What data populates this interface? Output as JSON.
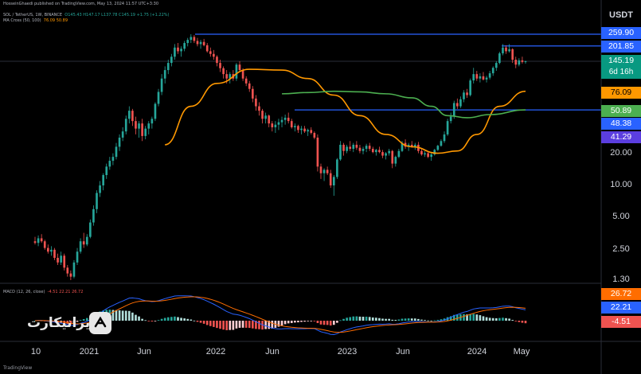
{
  "header": {
    "published": "HosseinGhaedi published on TradingView.com, May 13, 2024 11:57 UTC+3:30",
    "symbol_line": "SOL / TetherUS, 1W, BINANCE",
    "ohlc": "O145.43 H147.17 L137.78 C145.19 +1.75 (+1.22%)",
    "ma_line": "MA Cross (50, 100)",
    "ma_values": "76.09  50.89",
    "macd_line": "MACD (12, 26, close)",
    "macd_values": "-4.51  22.21  26.72"
  },
  "currency": "USDT",
  "price_tags": {
    "high": "259.90",
    "resistance": "201.85",
    "last": "145.19",
    "countdown": "6d 16h",
    "ma50": "76.09",
    "support1": "50.89",
    "support2": "48.38",
    "support3": "41.29",
    "macd": "26.72",
    "signal": "22.21",
    "hist": "-4.51"
  },
  "colors": {
    "up": "#26a69a",
    "down": "#ef5350",
    "level": "#2962ff",
    "ma50": "#ff9800",
    "ma100": "#4caf50",
    "macd": "#2962ff",
    "signal": "#ff6d00",
    "last": "#089981",
    "tag_purple": "#5b3ee0"
  },
  "logo": {
    "text": "ایرانیکارت"
  },
  "footer": "TradingView",
  "chart_data": {
    "type": "candlestick",
    "scale": "log",
    "y_ticks": [
      1.3,
      2.5,
      5.0,
      10.0,
      20.0
    ],
    "x_ticks": [
      "10",
      "2021",
      "Jun",
      "2022",
      "Jun",
      "2023",
      "Jun",
      "2024",
      "May"
    ],
    "levels": [
      259.9,
      201.85,
      50.89
    ],
    "candles": [
      [
        3.0,
        3.3,
        2.8,
        2.9
      ],
      [
        2.9,
        3.4,
        2.7,
        3.2
      ],
      [
        3.2,
        3.5,
        2.9,
        3.0
      ],
      [
        3.0,
        3.1,
        2.5,
        2.6
      ],
      [
        2.6,
        2.8,
        2.3,
        2.4
      ],
      [
        2.4,
        2.7,
        2.2,
        2.5
      ],
      [
        2.5,
        2.6,
        2.0,
        2.1
      ],
      [
        2.1,
        2.3,
        1.8,
        1.9
      ],
      [
        1.9,
        2.4,
        1.8,
        2.2
      ],
      [
        2.2,
        2.3,
        1.6,
        1.7
      ],
      [
        1.7,
        1.8,
        1.4,
        1.5
      ],
      [
        1.5,
        1.6,
        1.3,
        1.4
      ],
      [
        1.4,
        2.0,
        1.35,
        1.9
      ],
      [
        1.9,
        2.6,
        1.8,
        2.4
      ],
      [
        2.4,
        3.2,
        2.3,
        3.0
      ],
      [
        3.0,
        3.6,
        2.6,
        2.8
      ],
      [
        2.8,
        3.5,
        2.7,
        3.3
      ],
      [
        3.3,
        4.8,
        3.2,
        4.5
      ],
      [
        4.5,
        6.5,
        4.2,
        6.0
      ],
      [
        6.0,
        9.0,
        5.5,
        8.5
      ],
      [
        8.5,
        11.0,
        7.8,
        10.0
      ],
      [
        10.0,
        13.0,
        9.0,
        12.5
      ],
      [
        12.5,
        16.0,
        11.5,
        15.0
      ],
      [
        15.0,
        18.5,
        14.0,
        17.0
      ],
      [
        17.0,
        20.0,
        15.5,
        18.5
      ],
      [
        18.5,
        25.0,
        17.5,
        23.0
      ],
      [
        23.0,
        30.0,
        21.0,
        28.0
      ],
      [
        28.0,
        35.0,
        26.0,
        32.0
      ],
      [
        32.0,
        45.0,
        30.0,
        42.0
      ],
      [
        42.0,
        55.0,
        38.0,
        50.0
      ],
      [
        50.0,
        52.0,
        36.0,
        40.0
      ],
      [
        40.0,
        44.0,
        30.0,
        34.0
      ],
      [
        34.0,
        40.0,
        28.0,
        38.0
      ],
      [
        38.0,
        42.0,
        26.0,
        29.0
      ],
      [
        29.0,
        36.0,
        27.0,
        34.0
      ],
      [
        34.0,
        40.0,
        30.0,
        38.0
      ],
      [
        38.0,
        44.0,
        34.0,
        42.0
      ],
      [
        42.0,
        60.0,
        40.0,
        58.0
      ],
      [
        58.0,
        80.0,
        55.0,
        75.0
      ],
      [
        75.0,
        110.0,
        70.0,
        100.0
      ],
      [
        100.0,
        130.0,
        90.0,
        120.0
      ],
      [
        120.0,
        150.0,
        110.0,
        140.0
      ],
      [
        140.0,
        170.0,
        130.0,
        160.0
      ],
      [
        160.0,
        210.0,
        150.0,
        195.0
      ],
      [
        195.0,
        215.0,
        170.0,
        180.0
      ],
      [
        180.0,
        200.0,
        160.0,
        190.0
      ],
      [
        190.0,
        225.0,
        180.0,
        215.0
      ],
      [
        215.0,
        240.0,
        200.0,
        230.0
      ],
      [
        230.0,
        260.0,
        215.0,
        245.0
      ],
      [
        245.0,
        255.0,
        215.0,
        225.0
      ],
      [
        225.0,
        240.0,
        200.0,
        210.0
      ],
      [
        210.0,
        230.0,
        190.0,
        220.0
      ],
      [
        220.0,
        235.0,
        200.0,
        205.0
      ],
      [
        205.0,
        215.0,
        175.0,
        180.0
      ],
      [
        180.0,
        195.0,
        160.0,
        170.0
      ],
      [
        170.0,
        185.0,
        150.0,
        160.0
      ],
      [
        160.0,
        165.0,
        130.0,
        140.0
      ],
      [
        140.0,
        150.0,
        115.0,
        125.0
      ],
      [
        125.0,
        130.0,
        100.0,
        110.0
      ],
      [
        110.0,
        120.0,
        90.0,
        100.0
      ],
      [
        100.0,
        115.0,
        90.0,
        110.0
      ],
      [
        110.0,
        120.0,
        95.0,
        100.0
      ],
      [
        100.0,
        140.0,
        95.0,
        135.0
      ],
      [
        135.0,
        145.0,
        115.0,
        120.0
      ],
      [
        120.0,
        125.0,
        95.0,
        100.0
      ],
      [
        100.0,
        105.0,
        85.0,
        90.0
      ],
      [
        90.0,
        95.0,
        75.0,
        80.0
      ],
      [
        80.0,
        85.0,
        60.0,
        65.0
      ],
      [
        65.0,
        70.0,
        50.0,
        55.0
      ],
      [
        55.0,
        60.0,
        45.0,
        50.0
      ],
      [
        50.0,
        52.0,
        38.0,
        42.0
      ],
      [
        42.0,
        48.0,
        38.0,
        45.0
      ],
      [
        45.0,
        46.0,
        35.0,
        38.0
      ],
      [
        38.0,
        40.0,
        32.0,
        35.0
      ],
      [
        35.0,
        40.0,
        31.0,
        37.0
      ],
      [
        37.0,
        42.0,
        33.0,
        39.0
      ],
      [
        39.0,
        44.0,
        35.0,
        41.0
      ],
      [
        41.0,
        46.0,
        37.0,
        43.0
      ],
      [
        43.0,
        48.0,
        38.0,
        40.0
      ],
      [
        40.0,
        42.0,
        34.0,
        35.0
      ],
      [
        35.0,
        38.0,
        32.0,
        36.0
      ],
      [
        36.0,
        37.0,
        31.0,
        33.0
      ],
      [
        33.0,
        36.0,
        30.0,
        34.0
      ],
      [
        34.0,
        36.0,
        31.0,
        32.0
      ],
      [
        32.0,
        34.0,
        29.0,
        33.0
      ],
      [
        33.0,
        35.0,
        30.0,
        31.0
      ],
      [
        31.0,
        32.0,
        27.0,
        28.0
      ],
      [
        28.0,
        30.0,
        13.5,
        15.0
      ],
      [
        15.0,
        16.0,
        11.5,
        13.0
      ],
      [
        13.0,
        14.5,
        11.0,
        14.0
      ],
      [
        14.0,
        15.0,
        12.5,
        13.0
      ],
      [
        13.0,
        14.0,
        9.5,
        10.0
      ],
      [
        10.0,
        12.5,
        8.0,
        12.0
      ],
      [
        12.0,
        18.0,
        11.5,
        17.5
      ],
      [
        17.5,
        26.0,
        17.0,
        24.0
      ],
      [
        24.0,
        25.0,
        19.0,
        21.0
      ],
      [
        21.0,
        24.0,
        20.0,
        23.0
      ],
      [
        23.0,
        26.0,
        21.0,
        22.0
      ],
      [
        22.0,
        25.0,
        20.5,
        24.0
      ],
      [
        24.0,
        26.0,
        21.5,
        22.5
      ],
      [
        22.5,
        24.0,
        20.0,
        21.0
      ],
      [
        21.0,
        23.0,
        19.5,
        22.0
      ],
      [
        22.0,
        24.5,
        20.5,
        23.5
      ],
      [
        23.5,
        25.0,
        21.0,
        22.0
      ],
      [
        22.0,
        23.0,
        20.0,
        20.5
      ],
      [
        20.5,
        22.0,
        19.0,
        21.5
      ],
      [
        21.5,
        23.0,
        20.0,
        20.5
      ],
      [
        20.5,
        21.5,
        18.0,
        19.0
      ],
      [
        19.0,
        20.5,
        17.5,
        20.0
      ],
      [
        20.0,
        22.0,
        19.0,
        21.0
      ],
      [
        21.0,
        21.5,
        14.5,
        16.0
      ],
      [
        16.0,
        19.0,
        15.0,
        18.5
      ],
      [
        18.5,
        22.0,
        18.0,
        21.0
      ],
      [
        21.0,
        26.0,
        20.5,
        25.0
      ],
      [
        25.0,
        27.0,
        22.0,
        23.0
      ],
      [
        23.0,
        25.0,
        21.0,
        24.0
      ],
      [
        24.0,
        26.0,
        22.5,
        23.0
      ],
      [
        23.0,
        25.0,
        21.5,
        24.0
      ],
      [
        24.0,
        25.5,
        20.0,
        21.0
      ],
      [
        21.0,
        22.0,
        19.0,
        19.5
      ],
      [
        19.5,
        21.0,
        18.5,
        20.0
      ],
      [
        20.0,
        21.0,
        18.0,
        18.5
      ],
      [
        18.5,
        20.0,
        17.0,
        19.5
      ],
      [
        19.5,
        22.0,
        19.0,
        21.5
      ],
      [
        21.5,
        24.0,
        21.0,
        23.5
      ],
      [
        23.5,
        27.0,
        23.0,
        26.0
      ],
      [
        26.0,
        32.0,
        25.0,
        30.0
      ],
      [
        30.0,
        42.0,
        29.0,
        40.0
      ],
      [
        40.0,
        48.0,
        38.0,
        44.0
      ],
      [
        44.0,
        62.0,
        42.0,
        59.0
      ],
      [
        59.0,
        65.0,
        52.0,
        55.0
      ],
      [
        55.0,
        68.0,
        53.0,
        64.0
      ],
      [
        64.0,
        78.0,
        60.0,
        74.0
      ],
      [
        74.0,
        80.0,
        66.0,
        70.0
      ],
      [
        70.0,
        100.0,
        68.0,
        96.0
      ],
      [
        96.0,
        126.0,
        90.0,
        110.0
      ],
      [
        110.0,
        118.0,
        95.0,
        100.0
      ],
      [
        100.0,
        112.0,
        92.0,
        105.0
      ],
      [
        105.0,
        115.0,
        96.0,
        98.0
      ],
      [
        98.0,
        106.0,
        92.0,
        102.0
      ],
      [
        102.0,
        118.0,
        98.0,
        112.0
      ],
      [
        112.0,
        130.0,
        106.0,
        126.0
      ],
      [
        126.0,
        145.0,
        118.0,
        140.0
      ],
      [
        140.0,
        178.0,
        136.0,
        172.0
      ],
      [
        172.0,
        210.0,
        165.0,
        195.0
      ],
      [
        195.0,
        205.0,
        170.0,
        180.0
      ],
      [
        180.0,
        210.0,
        175.0,
        188.0
      ],
      [
        188.0,
        192.0,
        140.0,
        150.0
      ],
      [
        150.0,
        160.0,
        125.0,
        135.0
      ],
      [
        135.0,
        155.0,
        130.0,
        148.0
      ],
      [
        148.0,
        160.0,
        138.0,
        143.0
      ],
      [
        143.0,
        147.0,
        137.78,
        145.19
      ]
    ],
    "ma50": [
      [
        0,
        null
      ],
      [
        40,
        24
      ],
      [
        48,
        55
      ],
      [
        56,
        90
      ],
      [
        66,
        122
      ],
      [
        76,
        120
      ],
      [
        84,
        100
      ],
      [
        92,
        70
      ],
      [
        100,
        45
      ],
      [
        108,
        30
      ],
      [
        116,
        23
      ],
      [
        124,
        20
      ],
      [
        130,
        21
      ],
      [
        136,
        30
      ],
      [
        143,
        55
      ],
      [
        151,
        76.09
      ]
    ],
    "ma100": [
      [
        0,
        null
      ],
      [
        76,
        72
      ],
      [
        84,
        74
      ],
      [
        92,
        76
      ],
      [
        100,
        75
      ],
      [
        108,
        72
      ],
      [
        116,
        66
      ],
      [
        122,
        55
      ],
      [
        127,
        45
      ],
      [
        133,
        43
      ],
      [
        140,
        46
      ],
      [
        151,
        50.89
      ]
    ],
    "macd_series": {
      "macd_value": 26.72,
      "signal_value": 22.21,
      "hist_value": -4.51
    }
  }
}
